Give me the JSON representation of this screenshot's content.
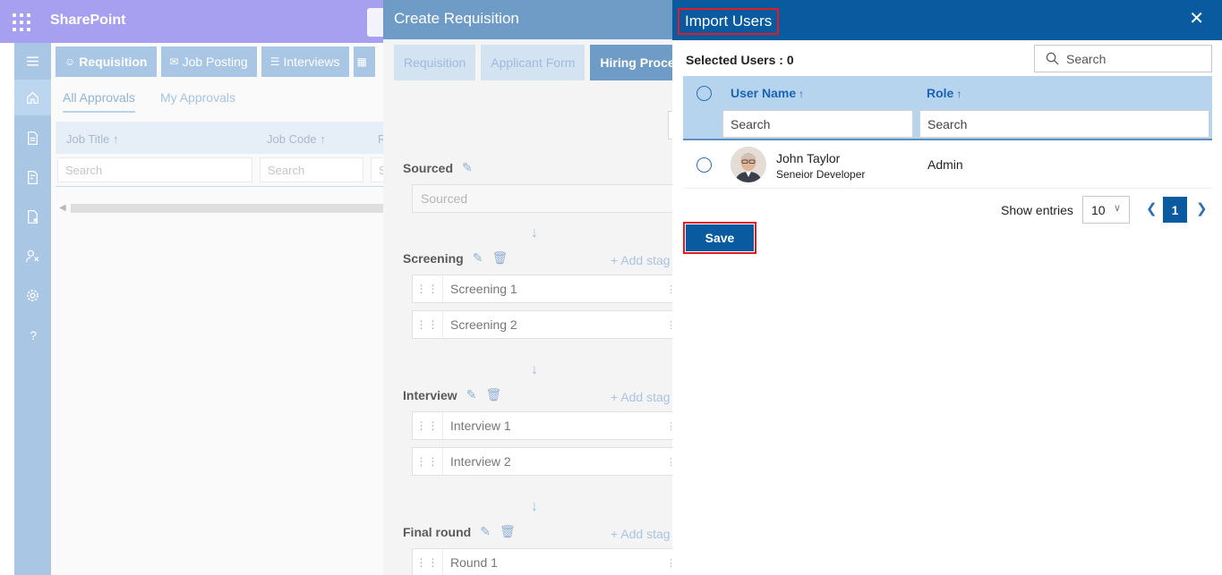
{
  "app": {
    "title": "SharePoint",
    "tabs": [
      {
        "label": "Requisition",
        "icon": "person-icon"
      },
      {
        "label": "Job Posting",
        "icon": "posting-icon"
      },
      {
        "label": "Interviews",
        "icon": "interview-icon"
      }
    ],
    "sub_tabs": [
      "All Approvals",
      "My Approvals"
    ],
    "grid_columns": [
      "Job Title ↑",
      "Job Code ↑",
      "R"
    ],
    "grid_search_placeholder": "Search",
    "grid_search_partial": "S"
  },
  "requisition_panel": {
    "title": "Create Requisition",
    "tabs": [
      "Requisition",
      "Applicant Form",
      "Hiring Proces"
    ],
    "stages": [
      {
        "name": "Sourced",
        "placeholder": "Sourced",
        "items": []
      },
      {
        "name": "Screening",
        "add_label": "Add stag",
        "items": [
          "Screening 1",
          "Screening 2"
        ]
      },
      {
        "name": "Interview",
        "add_label": "Add stag",
        "items": [
          "Interview 1",
          "Interview 2"
        ]
      },
      {
        "name": "Final round",
        "add_label": "Add stag",
        "items": [
          "Round 1"
        ]
      }
    ]
  },
  "import_panel": {
    "title": "Import Users",
    "selected_label": "Selected Users : 0",
    "search_placeholder": "Search",
    "columns": {
      "user_name": "User Name",
      "role": "Role",
      "sort_glyph": "↑",
      "filter_placeholder": "Search"
    },
    "rows": [
      {
        "name": "John Taylor",
        "job_title": "Seneior Developer",
        "role": "Admin"
      }
    ],
    "show_entries_label": "Show entries",
    "page_size": "10",
    "current_page": "1",
    "save_label": "Save"
  },
  "colors": {
    "brand_blue": "#0a5aa0",
    "highlight_red": "#e11b22",
    "header_light": "#b7d4ef"
  }
}
